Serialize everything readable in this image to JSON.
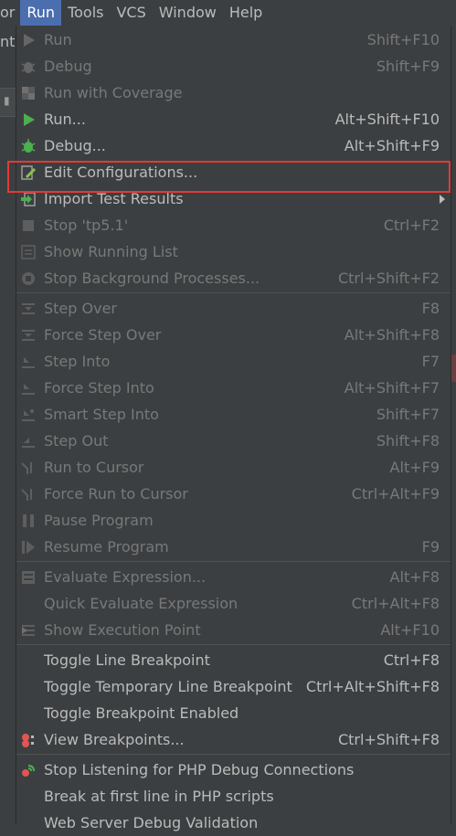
{
  "menubar": {
    "items": [
      {
        "label": "or"
      },
      {
        "label": "Run"
      },
      {
        "label": "Tools"
      },
      {
        "label": "VCS"
      },
      {
        "label": "Window"
      },
      {
        "label": "Help"
      }
    ]
  },
  "left_fragment": "ntr",
  "menu": {
    "items": [
      {
        "label": "Run",
        "shortcut": "Shift+F10",
        "icon": "run-icon",
        "enabled": false
      },
      {
        "label": "Debug",
        "shortcut": "Shift+F9",
        "icon": "debug-icon",
        "enabled": false
      },
      {
        "label": "Run with Coverage",
        "shortcut": "",
        "icon": "coverage-icon",
        "enabled": false
      },
      {
        "label": "Run...",
        "shortcut": "Alt+Shift+F10",
        "icon": "run-icon",
        "enabled": true
      },
      {
        "label": "Debug...",
        "shortcut": "Alt+Shift+F9",
        "icon": "debug-icon",
        "enabled": true
      },
      {
        "label": "Edit Configurations...",
        "shortcut": "",
        "icon": "edit-config-icon",
        "enabled": true
      },
      {
        "label": "Import Test Results",
        "shortcut": "",
        "icon": "import-icon",
        "enabled": true,
        "submenu": true
      },
      {
        "label": "Stop 'tp5.1'",
        "shortcut": "Ctrl+F2",
        "icon": "stop-icon",
        "enabled": false
      },
      {
        "label": "Show Running List",
        "shortcut": "",
        "icon": "list-icon",
        "enabled": false
      },
      {
        "label": "Stop Background Processes...",
        "shortcut": "Ctrl+Shift+F2",
        "icon": "stop-bg-icon",
        "enabled": false
      },
      {
        "label": "Step Over",
        "shortcut": "F8",
        "icon": "step-over-icon",
        "enabled": false
      },
      {
        "label": "Force Step Over",
        "shortcut": "Alt+Shift+F8",
        "icon": "force-step-over-icon",
        "enabled": false
      },
      {
        "label": "Step Into",
        "shortcut": "F7",
        "icon": "step-into-icon",
        "enabled": false
      },
      {
        "label": "Force Step Into",
        "shortcut": "Alt+Shift+F7",
        "icon": "force-step-into-icon",
        "enabled": false
      },
      {
        "label": "Smart Step Into",
        "shortcut": "Shift+F7",
        "icon": "smart-step-into-icon",
        "enabled": false
      },
      {
        "label": "Step Out",
        "shortcut": "Shift+F8",
        "icon": "step-out-icon",
        "enabled": false
      },
      {
        "label": "Run to Cursor",
        "shortcut": "Alt+F9",
        "icon": "run-to-cursor-icon",
        "enabled": false
      },
      {
        "label": "Force Run to Cursor",
        "shortcut": "Ctrl+Alt+F9",
        "icon": "force-run-to-cursor-icon",
        "enabled": false
      },
      {
        "label": "Pause Program",
        "shortcut": "",
        "icon": "pause-icon",
        "enabled": false
      },
      {
        "label": "Resume Program",
        "shortcut": "F9",
        "icon": "resume-icon",
        "enabled": false
      },
      {
        "label": "Evaluate Expression...",
        "shortcut": "Alt+F8",
        "icon": "evaluate-icon",
        "enabled": false
      },
      {
        "label": "Quick Evaluate Expression",
        "shortcut": "Ctrl+Alt+F8",
        "icon": "",
        "enabled": false
      },
      {
        "label": "Show Execution Point",
        "shortcut": "Alt+F10",
        "icon": "execution-point-icon",
        "enabled": false
      },
      {
        "label": "Toggle Line Breakpoint",
        "shortcut": "Ctrl+F8",
        "icon": "",
        "enabled": true
      },
      {
        "label": "Toggle Temporary Line Breakpoint",
        "shortcut": "Ctrl+Alt+Shift+F8",
        "icon": "",
        "enabled": true
      },
      {
        "label": "Toggle Breakpoint Enabled",
        "shortcut": "",
        "icon": "",
        "enabled": true
      },
      {
        "label": "View Breakpoints...",
        "shortcut": "Ctrl+Shift+F8",
        "icon": "breakpoints-icon",
        "enabled": true
      },
      {
        "label": "Stop Listening for PHP Debug Connections",
        "shortcut": "",
        "icon": "php-listen-icon",
        "enabled": true
      },
      {
        "label": "Break at first line in PHP scripts",
        "shortcut": "",
        "icon": "",
        "enabled": true
      },
      {
        "label": "Web Server Debug Validation",
        "shortcut": "",
        "icon": "",
        "enabled": true
      }
    ]
  },
  "colors": {
    "background": "#3c3f41",
    "active_menu": "#4b6eaf",
    "highlight_box": "#e53935",
    "run_green": "#4caf50",
    "disabled_text": "#787878"
  }
}
